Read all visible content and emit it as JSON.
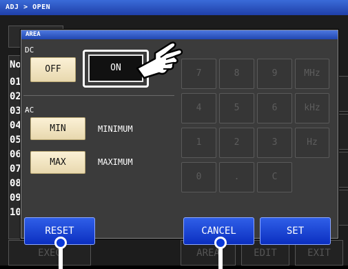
{
  "header": {
    "breadcrumb": "ADJ > OPEN"
  },
  "background": {
    "list_header": "No",
    "list_rows": [
      "01",
      "02",
      "03",
      "04",
      "05",
      "06",
      "07",
      "08",
      "09",
      "10"
    ],
    "bottom_buttons": [
      "EXEC",
      "AREA",
      "EDIT",
      "EXIT"
    ]
  },
  "dialog": {
    "title": "AREA",
    "dc": {
      "label": "DC",
      "off_label": "OFF",
      "on_label": "ON"
    },
    "ac": {
      "label": "AC",
      "min_label": "MIN",
      "min_desc": "MINIMUM",
      "max_label": "MAX",
      "max_desc": "MAXIMUM"
    },
    "keypad": [
      "7",
      "8",
      "9",
      "MHz",
      "4",
      "5",
      "6",
      "kHz",
      "1",
      "2",
      "3",
      "Hz",
      "0",
      ".",
      "C"
    ],
    "reset_label": "RESET",
    "cancel_label": "CANCEL",
    "set_label": "SET"
  },
  "colors": {
    "title_blue": "#2147b0",
    "button_blue": "#0b2fc0",
    "beige": "#f4e7c4"
  }
}
